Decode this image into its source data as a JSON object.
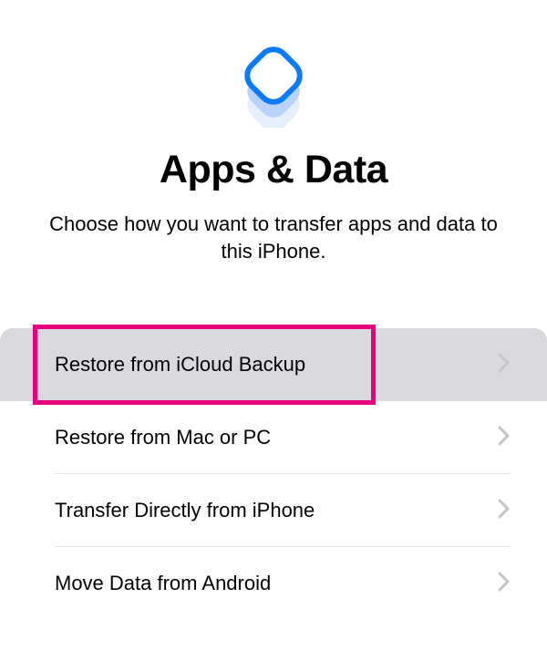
{
  "header": {
    "title": "Apps & Data",
    "subtitle": "Choose how you want to transfer apps and data to this iPhone."
  },
  "options": [
    {
      "label": "Restore from iCloud Backup",
      "selected": true,
      "highlighted": true
    },
    {
      "label": "Restore from Mac or PC",
      "selected": false,
      "highlighted": false
    },
    {
      "label": "Transfer Directly from iPhone",
      "selected": false,
      "highlighted": false
    },
    {
      "label": "Move Data from Android",
      "selected": false,
      "highlighted": false
    }
  ],
  "icons": {
    "chevron": "chevron-right",
    "hero": "apps-data-stack"
  },
  "highlight": {
    "color": "#e6007e"
  }
}
